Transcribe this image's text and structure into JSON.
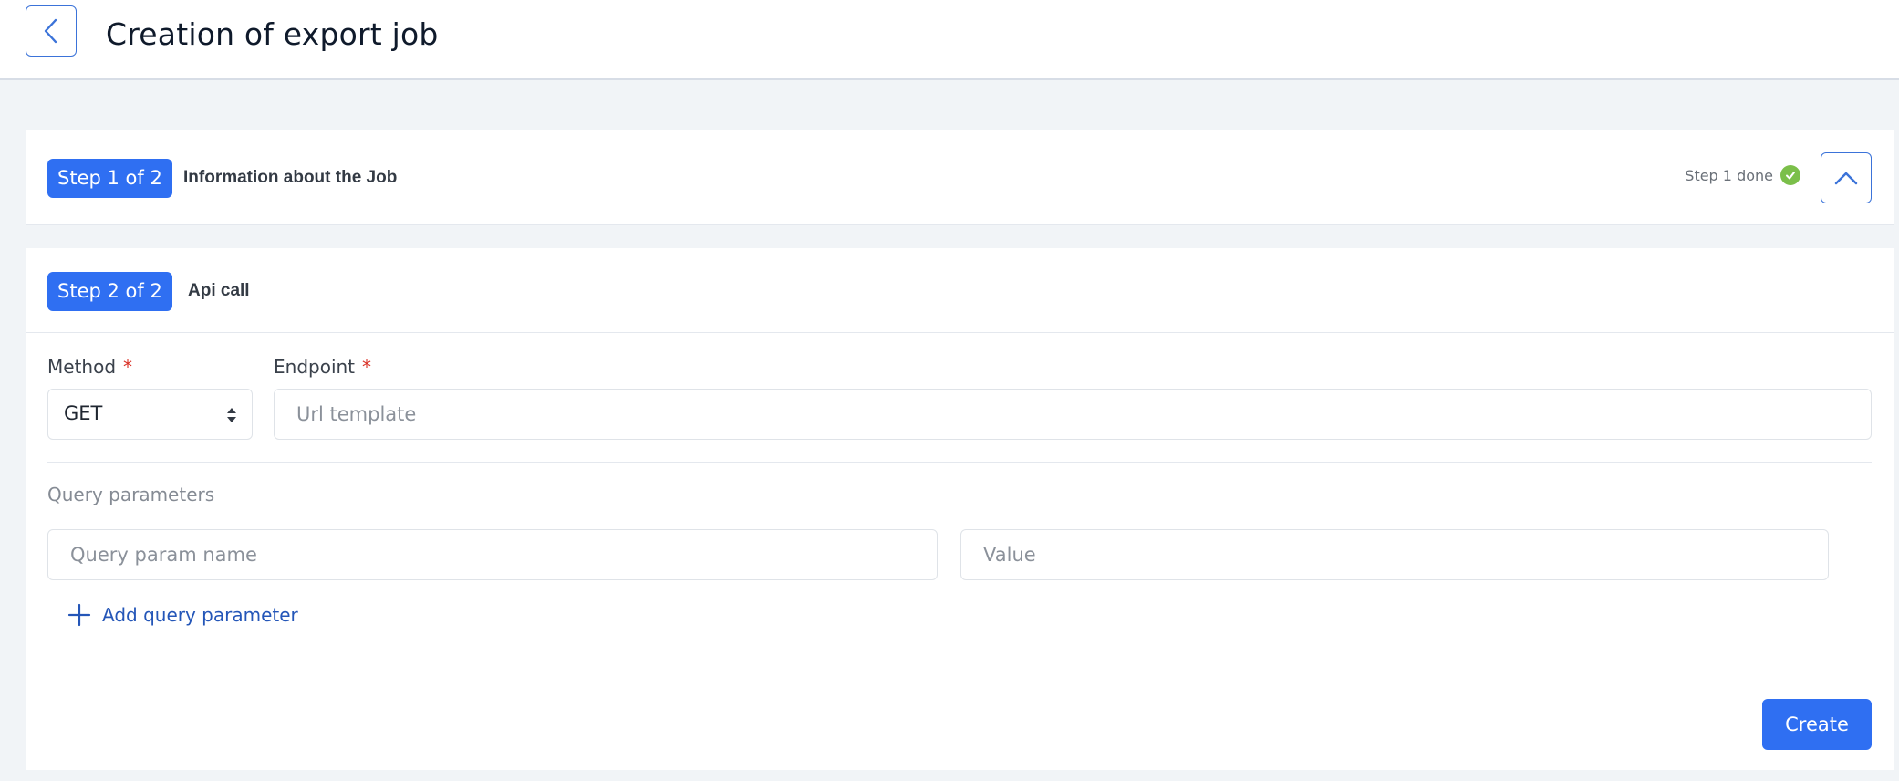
{
  "header": {
    "title": "Creation of export job",
    "back_icon": "chevron-left-icon"
  },
  "step1": {
    "badge": "Step 1 of 2",
    "title": "Information about the Job",
    "status": "Step 1 done",
    "status_icon": "check-circle-icon",
    "collapse_icon": "chevron-up-icon"
  },
  "step2": {
    "badge": "Step 2 of 2",
    "title": "Api call",
    "method": {
      "label": "Method",
      "required_mark": "*",
      "value": "GET"
    },
    "endpoint": {
      "label": "Endpoint",
      "required_mark": "*",
      "value": "",
      "placeholder": "Url template"
    },
    "query": {
      "section_label": "Query parameters",
      "name_placeholder": "Query param name",
      "value_placeholder": "Value",
      "add_label": "Add query parameter"
    },
    "create_label": "Create"
  },
  "colors": {
    "accent": "#2f6ff2",
    "link": "#2456b8",
    "success": "#7bbf4a",
    "required": "#d93025",
    "page_bg": "#f1f4f7"
  }
}
